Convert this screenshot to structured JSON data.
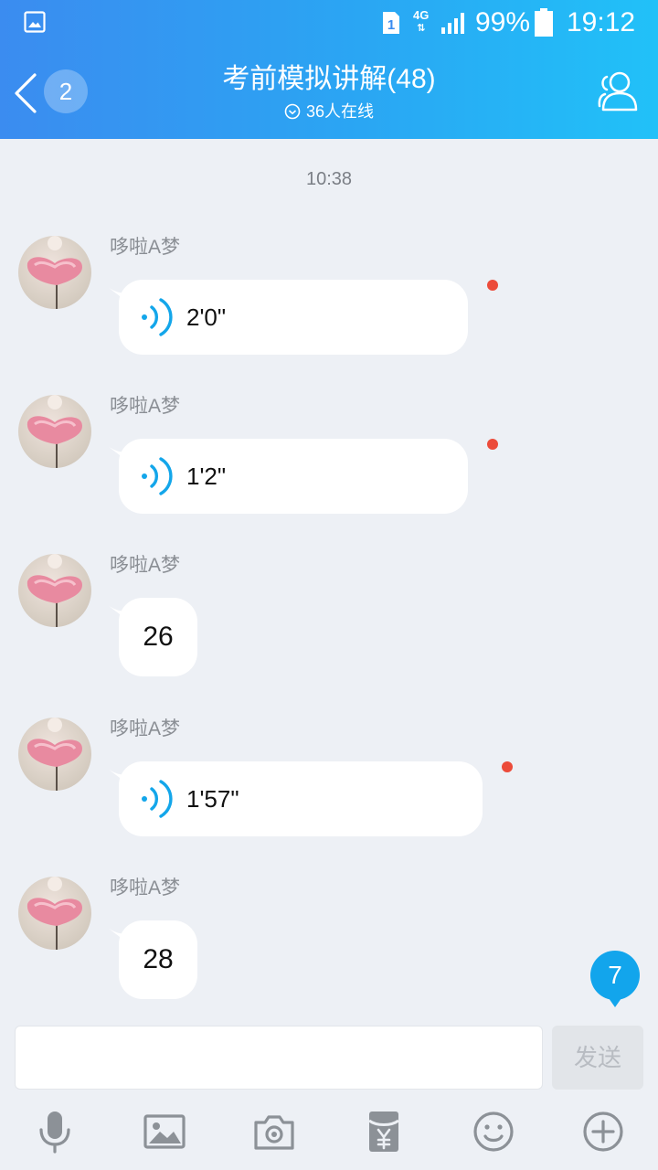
{
  "status_bar": {
    "sim_label": "1",
    "network": "4G",
    "battery": "99%",
    "time": "19:12"
  },
  "header": {
    "unread_count": "2",
    "title": "考前模拟讲解(48)",
    "online": "36人在线"
  },
  "chat": {
    "time_separator": "10:38",
    "messages": [
      {
        "sender": "哆啦A梦",
        "type": "voice",
        "duration": "2'0\"",
        "unread": true
      },
      {
        "sender": "哆啦A梦",
        "type": "voice",
        "duration": "1'2\"",
        "unread": true
      },
      {
        "sender": "哆啦A梦",
        "type": "text",
        "text": "26"
      },
      {
        "sender": "哆啦A梦",
        "type": "voice",
        "duration": "1'57\"",
        "unread": true
      },
      {
        "sender": "哆啦A梦",
        "type": "text",
        "text": "28"
      }
    ],
    "new_message_count": "7"
  },
  "input": {
    "value": "",
    "send_label": "发送"
  },
  "toolbar": {
    "items": [
      "mic-icon",
      "image-icon",
      "camera-icon",
      "red-packet-icon",
      "emoji-icon",
      "plus-icon"
    ]
  },
  "colors": {
    "header_start": "#3b8cf0",
    "header_end": "#21c1f8",
    "accent": "#12a5ec",
    "unread_dot": "#ec4b3a",
    "chat_bg": "#edf0f5"
  }
}
